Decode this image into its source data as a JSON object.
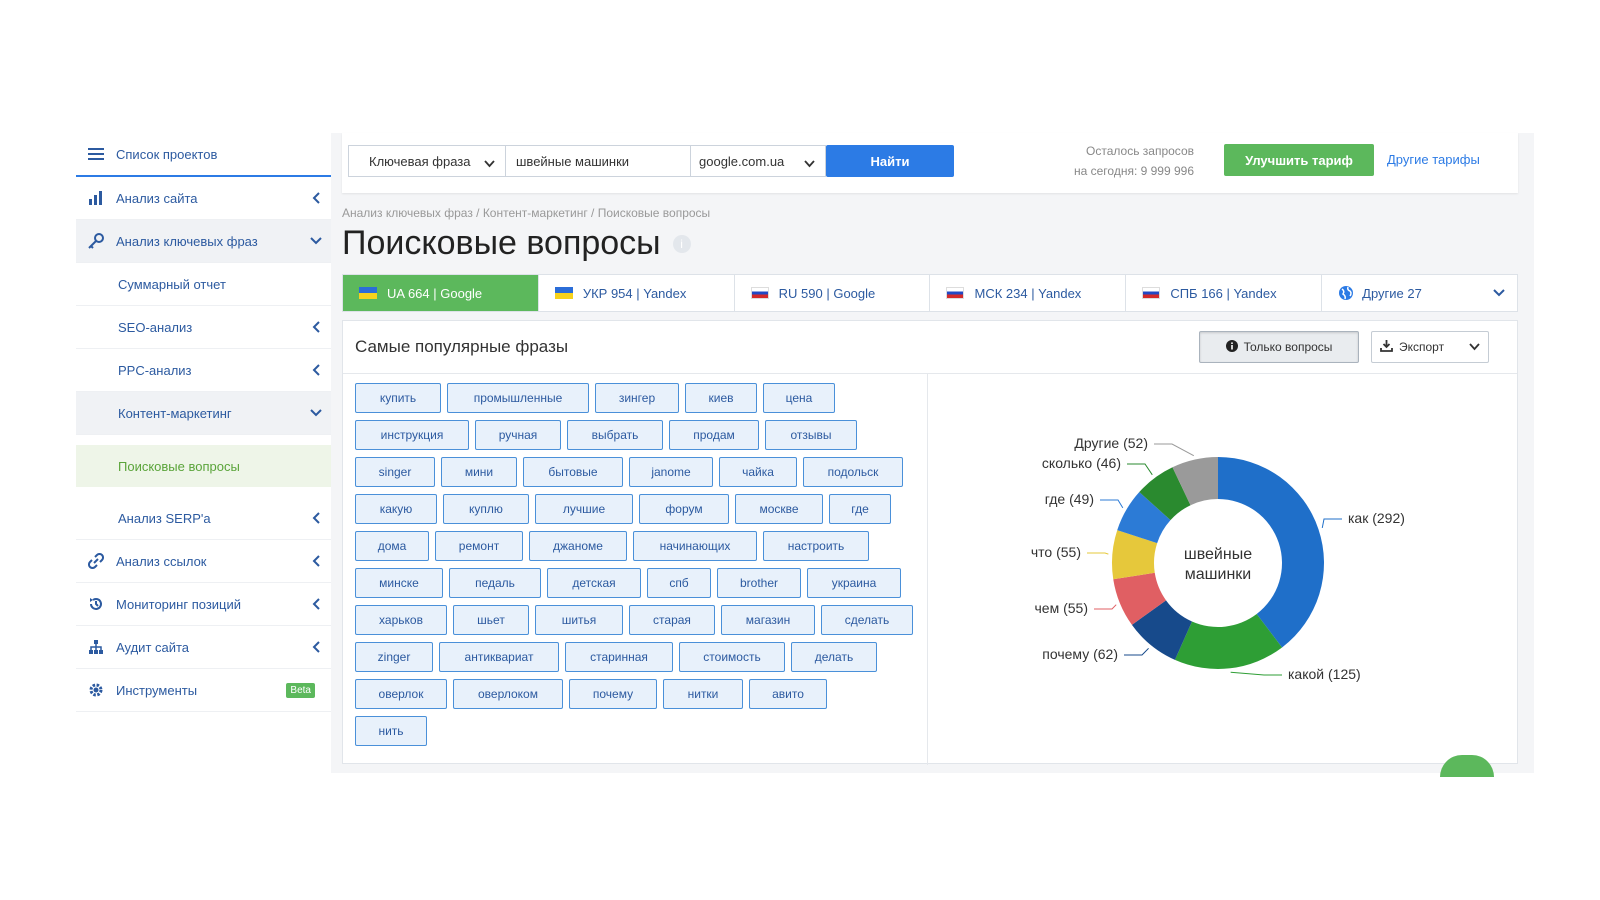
{
  "sidebar": {
    "items": [
      {
        "label": "Список проектов",
        "icon": "menu-icon"
      },
      {
        "label": "Анализ сайта",
        "icon": "site-analysis-icon"
      },
      {
        "label": "Анализ ключевых фраз",
        "icon": "key-icon"
      },
      {
        "label": "Суммарный отчет"
      },
      {
        "label": "SEO-анализ"
      },
      {
        "label": "PPC-анализ"
      },
      {
        "label": "Контент-маркетинг"
      },
      {
        "label": "Поисковые вопросы"
      },
      {
        "label": "Анализ SERP'а"
      },
      {
        "label": "Анализ ссылок",
        "icon": "link-icon"
      },
      {
        "label": "Мониторинг позиций",
        "icon": "history-icon"
      },
      {
        "label": "Аудит сайта",
        "icon": "sitemap-icon"
      },
      {
        "label": "Инструменты",
        "icon": "gear-icon",
        "badge": "Beta"
      }
    ]
  },
  "search": {
    "mode": "Ключевая фраза",
    "query": "швейные машинки",
    "engine": "google.com.ua",
    "submit": "Найти"
  },
  "quota": {
    "line1": "Осталось запросов",
    "line2": "на сегодня: 9 999 996"
  },
  "upgrade_label": "Улучшить тариф",
  "tariffs_link": "Другие тарифы",
  "breadcrumb": "Анализ ключевых фраз / Контент-маркетинг / Поисковые вопросы",
  "page_title": "Поисковые вопросы",
  "region_tabs": [
    {
      "label": "UA 664 | Google",
      "flag": "ua"
    },
    {
      "label": "УКР 954 | Yandex",
      "flag": "ua"
    },
    {
      "label": "RU 590 | Google",
      "flag": "ru"
    },
    {
      "label": "МСК 234 | Yandex",
      "flag": "ru"
    },
    {
      "label": "СПБ 166 | Yandex",
      "flag": "ru"
    },
    {
      "label": "Другие 27",
      "flag": "globe"
    }
  ],
  "panel": {
    "title": "Самые популярные фразы",
    "only_questions": "Только вопросы",
    "export": "Экспорт"
  },
  "tags": [
    [
      "купить",
      "промышленные",
      "зингер",
      "киев",
      "цена"
    ],
    [
      "инструкция",
      "ручная",
      "выбрать",
      "продам",
      "отзывы"
    ],
    [
      "singer",
      "мини",
      "бытовые",
      "janome",
      "чайка",
      "подольск"
    ],
    [
      "какую",
      "куплю",
      "лучшие",
      "форум",
      "москве",
      "где"
    ],
    [
      "дома",
      "ремонт",
      "джаноме",
      "начинающих",
      "настроить"
    ],
    [
      "минске",
      "педаль",
      "детская",
      "спб",
      "brother",
      "украина"
    ],
    [
      "харьков",
      "шьет",
      "шитья",
      "старая",
      "магазин",
      "сделать"
    ],
    [
      "zinger",
      "антиквариат",
      "старинная",
      "стоимость",
      "делать"
    ],
    [
      "оверлок",
      "оверлоком",
      "почему",
      "нитки",
      "авито"
    ],
    [
      "нить"
    ]
  ],
  "chart_data": {
    "type": "pie",
    "title": "",
    "center_label": [
      "швейные",
      "машинки"
    ],
    "slices": [
      {
        "label": "как (292)",
        "value": 292,
        "color": "#1f6fc9"
      },
      {
        "label": "какой (125)",
        "value": 125,
        "color": "#2e9e35"
      },
      {
        "label": "почему (62)",
        "value": 62,
        "color": "#174a8b"
      },
      {
        "label": "чем (55)",
        "value": 55,
        "color": "#e05f63"
      },
      {
        "label": "что (55)",
        "value": 55,
        "color": "#e6c83b"
      },
      {
        "label": "где (49)",
        "value": 49,
        "color": "#2c7bd6"
      },
      {
        "label": "сколько (46)",
        "value": 46,
        "color": "#2a8a2f"
      },
      {
        "label": "Другие (52)",
        "value": 52,
        "color": "#9a9a9a"
      }
    ]
  }
}
